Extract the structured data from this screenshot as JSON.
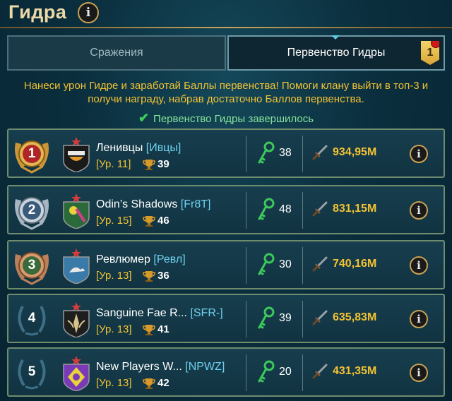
{
  "header": {
    "title": "Гидра",
    "info_icon": "i"
  },
  "tabs": [
    {
      "label": "Сражения",
      "active": false
    },
    {
      "label": "Первенство Гидры",
      "active": true,
      "badge": "1"
    }
  ],
  "description": "Нанеси урон Гидре и заработай Баллы первенства! Помоги клану выйти в топ-3 и получи награду, набрав достаточно Баллов первенства.",
  "status": {
    "text": "Первенство Гидры завершилось",
    "icon": "check-icon"
  },
  "clans": [
    {
      "rank": "1",
      "name": "Ленивцы",
      "tag": "[Ивцы]",
      "level": "[Ур. 11]",
      "cups": "39",
      "keys": "38",
      "damage": "934,95M"
    },
    {
      "rank": "2",
      "name": "Odin’s Shadows",
      "tag": "[Fr8T]",
      "level": "[Ур. 15]",
      "cups": "46",
      "keys": "48",
      "damage": "831,15M"
    },
    {
      "rank": "3",
      "name": "Ревлюмер",
      "tag": "[Ревл]",
      "level": "[Ур. 13]",
      "cups": "36",
      "keys": "30",
      "damage": "740,16M"
    },
    {
      "rank": "4",
      "name": "Sanguine Fae R...",
      "tag": "[SFR-]",
      "level": "[Ур. 13]",
      "cups": "41",
      "keys": "39",
      "damage": "635,83M"
    },
    {
      "rank": "5",
      "name": "New Players W...",
      "tag": "[NPWZ]",
      "level": "[Ур. 13]",
      "cups": "42",
      "keys": "20",
      "damage": "431,35M"
    }
  ],
  "colors": {
    "gold_text": "#f2c233",
    "tag_blue": "#6fd1f0",
    "status_green": "#86e29a",
    "key_green": "#3cc85a"
  }
}
